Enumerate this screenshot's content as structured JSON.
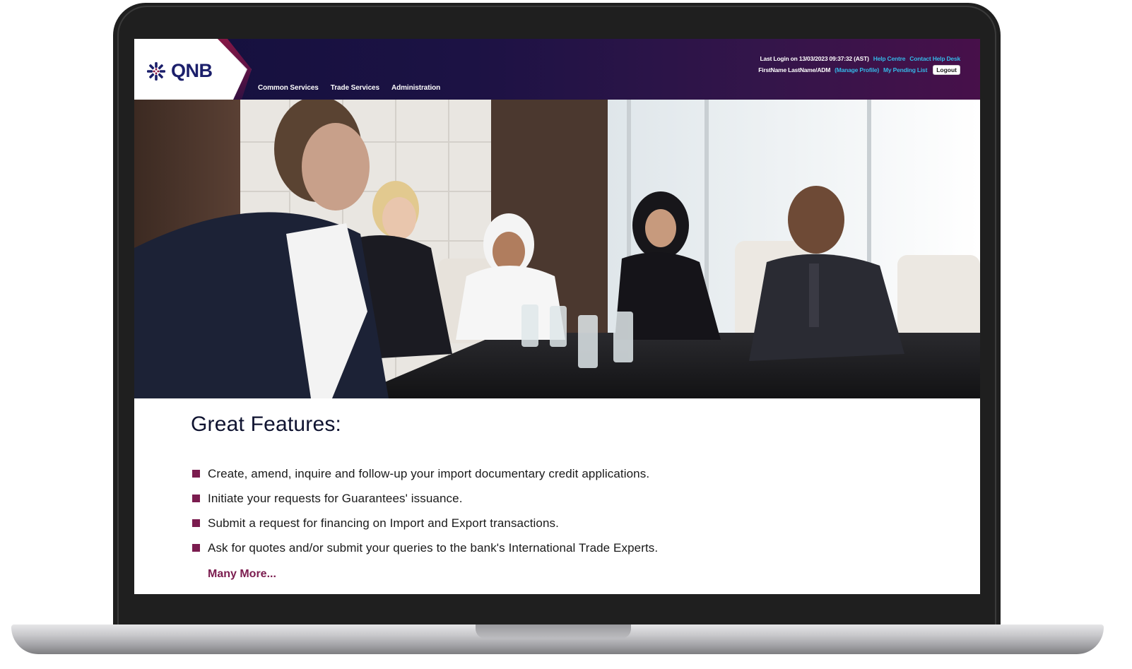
{
  "header": {
    "logo_text": "QNB",
    "logo_icon": "qnb-snowflake-icon",
    "nav": [
      "Common Services",
      "Trade Services",
      "Administration"
    ],
    "last_login": "Last Login on 13/03/2023 09:37:32 (AST)",
    "help_centre": "Help Centre",
    "contact_help_desk": "Contact Help Desk",
    "user_name": "FirstName LastName/ADM",
    "manage_profile": "(Manage Profile)",
    "pending_list": "My Pending List",
    "logout": "Logout"
  },
  "main": {
    "features_title": "Great Features:",
    "features": [
      "Create, amend, inquire and follow-up your import documentary credit applications.",
      "Initiate your requests for Guarantees' issuance.",
      "Submit a request for financing on Import and Export transactions.",
      "Ask for quotes and/or submit your queries to the bank's International Trade Experts."
    ],
    "many_more": "Many More..."
  },
  "colors": {
    "header_start": "#14103d",
    "header_end": "#47104a",
    "link": "#35b6e6",
    "accent": "#7b1c4f",
    "brand_blue": "#1b1f6b"
  }
}
